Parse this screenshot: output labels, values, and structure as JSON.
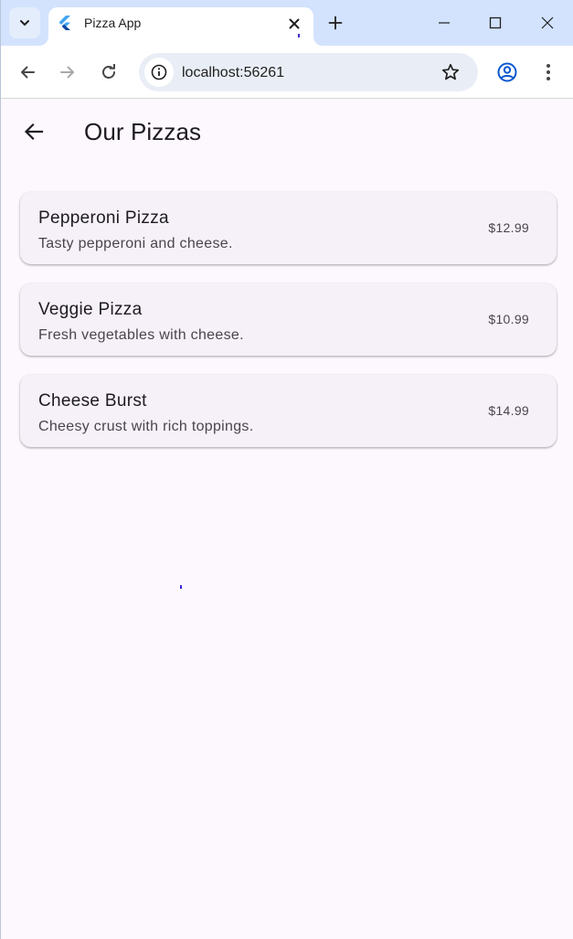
{
  "browser": {
    "tab": {
      "title": "Pizza App",
      "favicon": "flutter-icon"
    },
    "address": {
      "url": "localhost:56261"
    },
    "icons": {
      "tab_search": "chevron-down-icon",
      "close_tab": "close-icon",
      "new_tab": "plus-icon",
      "minimize": "minimize-icon",
      "maximize": "maximize-icon",
      "close_window": "close-icon",
      "back": "back-icon",
      "forward": "forward-icon",
      "reload": "reload-icon",
      "site_info": "info-icon",
      "bookmark": "star-icon",
      "profile": "profile-icon",
      "menu": "kebab-menu-icon"
    }
  },
  "app": {
    "title": "Our Pizzas",
    "back_icon": "arrow-back-icon",
    "pizzas": [
      {
        "name": "Pepperoni Pizza",
        "description": "Tasty pepperoni and cheese.",
        "price": "$12.99"
      },
      {
        "name": "Veggie Pizza",
        "description": "Fresh vegetables with cheese.",
        "price": "$10.99"
      },
      {
        "name": "Cheese Burst",
        "description": "Cheesy crust with rich toppings.",
        "price": "$14.99"
      }
    ]
  },
  "colors": {
    "tabstrip": "#d3e3fd",
    "page_background": "#fdf7fe",
    "card_background": "#f6f0f8",
    "profile_accent": "#0b57d0"
  }
}
